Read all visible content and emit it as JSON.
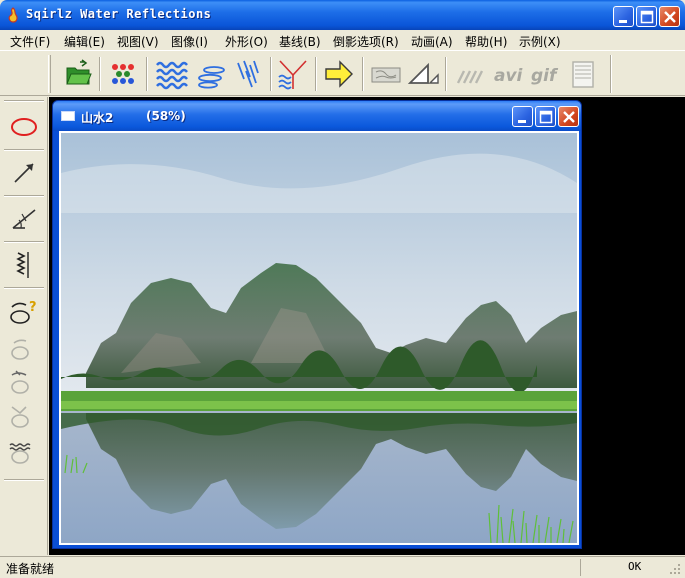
{
  "app": {
    "title": "Sqirlz Water Reflections"
  },
  "menu": [
    {
      "label": "文件(F)"
    },
    {
      "label": "编辑(E)"
    },
    {
      "label": "视图(V)"
    },
    {
      "label": "图像(I)"
    },
    {
      "label": "外形(O)"
    },
    {
      "label": "基线(B)"
    },
    {
      "label": "倒影选项(R)"
    },
    {
      "label": "动画(A)"
    },
    {
      "label": "帮助(H)"
    },
    {
      "label": "示例(X)"
    }
  ],
  "toolbar": {
    "avi_label": "avi",
    "gif_label": "gif",
    "icons": [
      "open-folder-icon",
      "palette-dots-icon",
      "wave-ripples-icon",
      "ellipse-ripples-icon",
      "rain-streaks-icon",
      "baseline-reflection-icon",
      "arrow-right-icon",
      "texture-icon",
      "perspective-icon",
      "disabled-waves-icon",
      "avi-export-icon",
      "gif-export-icon",
      "document-icon"
    ]
  },
  "left_tools": {
    "icons": [
      "ellipse-tool-icon",
      "arrow-tool-icon",
      "angle-tool-icon",
      "zigzag-tool-icon",
      "shape-help-icon",
      "shape-tool-1-icon",
      "shape-tool-2-icon",
      "shape-tool-3-icon",
      "shape-tool-4-icon"
    ]
  },
  "child_window": {
    "title": "山水2",
    "zoom": "(58%)"
  },
  "status": {
    "text": "准备就绪",
    "indicator": "OK"
  },
  "colors": {
    "title_blue": "#0a5fe0",
    "close_red": "#d2461e",
    "mdi_background": "#000000",
    "face": "#ece9d8"
  }
}
